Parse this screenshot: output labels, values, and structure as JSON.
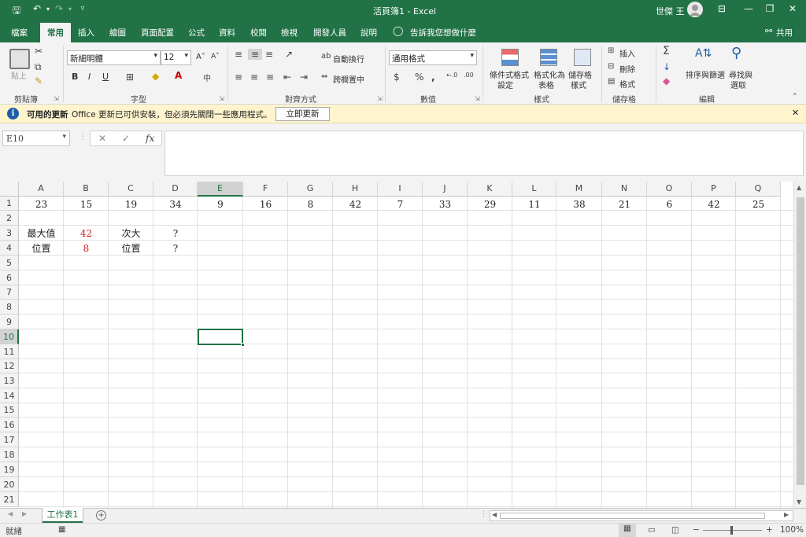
{
  "window": {
    "title": "活頁簿1  -  Excel",
    "user": "世傑 王",
    "quick_access": {
      "save_icon": "save-icon",
      "undo_icon": "undo-icon",
      "redo_icon": "redo-icon",
      "customize_icon": "customize-qat-icon"
    },
    "controls": [
      "ribbon-display-options-icon",
      "minimize-icon",
      "restore-icon",
      "close-icon"
    ]
  },
  "tabs": {
    "items": [
      "檔案",
      "常用",
      "插入",
      "繪圖",
      "頁面配置",
      "公式",
      "資料",
      "校閱",
      "檢視",
      "開發人員",
      "說明"
    ],
    "active": "常用",
    "tell_me": "告訴我您想做什麼",
    "share": "共用"
  },
  "ribbon": {
    "clipboard": {
      "label": "剪貼簿",
      "paste": "貼上"
    },
    "font": {
      "label": "字型",
      "name": "新細明體",
      "size": "12",
      "bold": "B",
      "italic": "I",
      "underline": "U",
      "grow": "A˄",
      "shrink": "A˅"
    },
    "alignment": {
      "label": "對齊方式",
      "wrap": "自動換行",
      "merge": "跨欄置中"
    },
    "number": {
      "label": "數值",
      "format": "通用格式"
    },
    "styles": {
      "label": "樣式",
      "conditional": [
        "條件式格式",
        "設定"
      ],
      "table": [
        "格式化為",
        "表格"
      ],
      "cell": [
        "儲存格",
        "樣式"
      ]
    },
    "cells": {
      "label": "儲存格",
      "insert": "插入",
      "delete": "刪除",
      "format": "格式"
    },
    "editing": {
      "label": "編輯",
      "sort": [
        "排序與篩選"
      ],
      "find": [
        "尋找與",
        "選取"
      ]
    }
  },
  "message_bar": {
    "title": "可用的更新",
    "text": "Office 更新已可供安裝，但必須先關閉一些應用程式。",
    "button": "立即更新"
  },
  "formula_bar": {
    "name_box": "E10",
    "cancel": "✕",
    "enter": "✓",
    "fx": "fx",
    "value": ""
  },
  "sheet": {
    "columns": [
      "A",
      "B",
      "C",
      "D",
      "E",
      "F",
      "G",
      "H",
      "I",
      "J",
      "K",
      "L",
      "M",
      "N",
      "O",
      "P",
      "Q"
    ],
    "rows": [
      "1",
      "2",
      "3",
      "4",
      "5",
      "6",
      "7",
      "8",
      "9",
      "10",
      "11",
      "12",
      "13",
      "14",
      "15",
      "16",
      "17",
      "18",
      "19",
      "20",
      "21"
    ],
    "selected_cell": "E10",
    "row1": [
      "23",
      "15",
      "19",
      "34",
      "9",
      "16",
      "8",
      "42",
      "7",
      "33",
      "29",
      "11",
      "38",
      "21",
      "6",
      "42",
      "25"
    ],
    "row3": {
      "a": "最大值",
      "b": "42",
      "c": "次大",
      "d": "?"
    },
    "row4": {
      "a": "位置",
      "b": "8",
      "c": "位置",
      "d": "?"
    },
    "highlight_color": "#d11f1f"
  },
  "sheet_tabs": {
    "active": "工作表1",
    "add": "+"
  },
  "status": {
    "text": "就緒",
    "zoom": "100%"
  },
  "colors": {
    "accent": "#217346",
    "message_bg": "#fff4ce",
    "info": "#1e5ea8"
  }
}
